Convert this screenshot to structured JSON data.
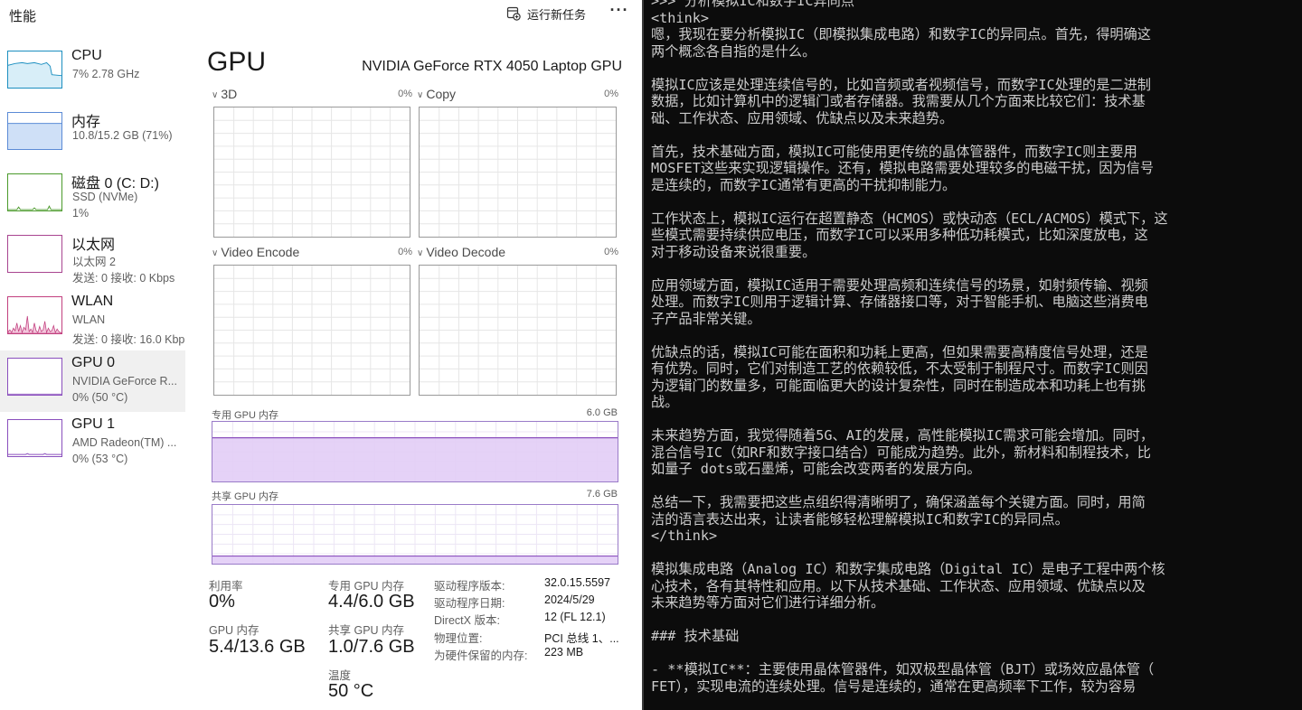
{
  "header": {
    "title": "性能",
    "run_task": "运行新任务",
    "more": "···"
  },
  "sidebar": {
    "items": [
      {
        "name": "CPU",
        "sub1": "7% 2.78 GHz",
        "sub2": "",
        "active": false,
        "kind": "cpu",
        "color": "#1c8fc0"
      },
      {
        "name": "内存",
        "sub1": "10.8/15.2 GB (71%)",
        "sub2": "",
        "active": false,
        "kind": "memory",
        "color": "#5b8bd6",
        "fill_fraction": 0.71
      },
      {
        "name": "磁盘 0 (C: D:)",
        "sub1": "SSD (NVMe)",
        "sub2": "1%",
        "active": false,
        "kind": "disk",
        "color": "#4b9a2b"
      },
      {
        "name": "以太网",
        "sub1": "以太网 2",
        "sub2": "发送: 0 接收: 0 Kbps",
        "active": false,
        "kind": "ethernet",
        "color": "#a84590"
      },
      {
        "name": "WLAN",
        "sub1": "WLAN",
        "sub2": "发送: 0 接收: 16.0 Kbp",
        "active": false,
        "kind": "wlan",
        "color": "#c2407f"
      },
      {
        "name": "GPU 0",
        "sub1": "NVIDIA GeForce R...",
        "sub2": "0% (50 °C)",
        "active": true,
        "kind": "gpu0",
        "color": "#8a4fbd"
      },
      {
        "name": "GPU 1",
        "sub1": "AMD Radeon(TM) ...",
        "sub2": "0% (53 °C)",
        "active": false,
        "kind": "gpu1",
        "color": "#8a4fbd"
      }
    ]
  },
  "main": {
    "title": "GPU",
    "model": "NVIDIA GeForce RTX 4050 Laptop GPU",
    "engines": [
      {
        "label": "3D",
        "pct": "0%"
      },
      {
        "label": "Copy",
        "pct": "0%"
      },
      {
        "label": "Video Encode",
        "pct": "0%"
      },
      {
        "label": "Video Decode",
        "pct": "0%"
      }
    ],
    "dedicated_mem": {
      "label": "专用 GPU 内存",
      "max": "6.0 GB",
      "fill_fraction": 0.733
    },
    "shared_mem": {
      "label": "共享 GPU 内存",
      "max": "7.6 GB",
      "fill_fraction": 0.13
    },
    "stats": {
      "util_label": "利用率",
      "util_value": "0%",
      "ded_label": "专用 GPU 内存",
      "ded_value": "4.4/6.0 GB",
      "gpu_mem_label": "GPU 内存",
      "gpu_mem_value": "5.4/13.6 GB",
      "shared_label": "共享 GPU 内存",
      "shared_value": "1.0/7.6 GB",
      "temp_label": "温度",
      "temp_value": "50 °C"
    },
    "props": [
      {
        "key": "驱动程序版本:",
        "value": "32.0.15.5597"
      },
      {
        "key": "驱动程序日期:",
        "value": "2024/5/29"
      },
      {
        "key": "DirectX 版本:",
        "value": "12 (FL 12.1)"
      },
      {
        "key": "物理位置:",
        "value": "PCI 总线 1、..."
      },
      {
        "key": "为硬件保留的内存:",
        "value": "223 MB"
      }
    ]
  },
  "terminal": {
    "lines": [
      ">>> 分析模拟IC和数字IC异同点",
      "<think>",
      "嗯，我现在要分析模拟IC（即模拟集成电路）和数字IC的异同点。首先，得明确这",
      "两个概念各自指的是什么。",
      "",
      "模拟IC应该是处理连续信号的，比如音频或者视频信号，而数字IC处理的是二进制",
      "数据，比如计算机中的逻辑门或者存储器。我需要从几个方面来比较它们：技术基",
      "础、工作状态、应用领域、优缺点以及未来趋势。",
      "",
      "首先，技术基础方面，模拟IC可能使用更传统的晶体管器件，而数字IC则主要用",
      "MOSFET这些来实现逻辑操作。还有，模拟电路需要处理较多的电磁干扰，因为信号",
      "是连续的，而数字IC通常有更高的干扰抑制能力。",
      "",
      "工作状态上，模拟IC运行在超置静态（HCMOS）或快动态（ECL/ACMOS）模式下，这",
      "些模式需要持续供应电压，而数字IC可以采用多种低功耗模式，比如深度放电，这",
      "对于移动设备来说很重要。",
      "",
      "应用领域方面，模拟IC适用于需要处理高频和连续信号的场景，如射频传输、视频",
      "处理。而数字IC则用于逻辑计算、存储器接口等，对于智能手机、电脑这些消费电",
      "子产品非常关键。",
      "",
      "优缺点的话，模拟IC可能在面积和功耗上更高，但如果需要高精度信号处理，还是",
      "有优势。同时，它们对制造工艺的依赖较低，不太受制于制程尺寸。而数字IC则因",
      "为逻辑门的数量多，可能面临更大的设计复杂性，同时在制造成本和功耗上也有挑",
      "战。",
      "",
      "未来趋势方面，我觉得随着5G、AI的发展，高性能模拟IC需求可能会增加。同时，",
      "混合信号IC（如RF和数字接口结合）可能成为趋势。此外，新材料和制程技术，比",
      "如量子 dots或石墨烯，可能会改变两者的发展方向。",
      "",
      "总结一下，我需要把这些点组织得清晰明了，确保涵盖每个关键方面。同时，用简",
      "洁的语言表达出来，让读者能够轻松理解模拟IC和数字IC的异同点。",
      "</think>",
      "",
      "模拟集成电路（Analog IC）和数字集成电路（Digital IC）是电子工程中两个核",
      "心技术，各有其特性和应用。以下从技术基础、工作状态、应用领域、优缺点以及",
      "未来趋势等方面对它们进行详细分析。",
      "",
      "### 技术基础",
      "",
      "- **模拟IC**：主要使用晶体管器件，如双极型晶体管（BJT）或场效应晶体管（",
      "FET），实现电流的连续处理。信号是连续的，通常在更高频率下工作，较为容易"
    ]
  }
}
